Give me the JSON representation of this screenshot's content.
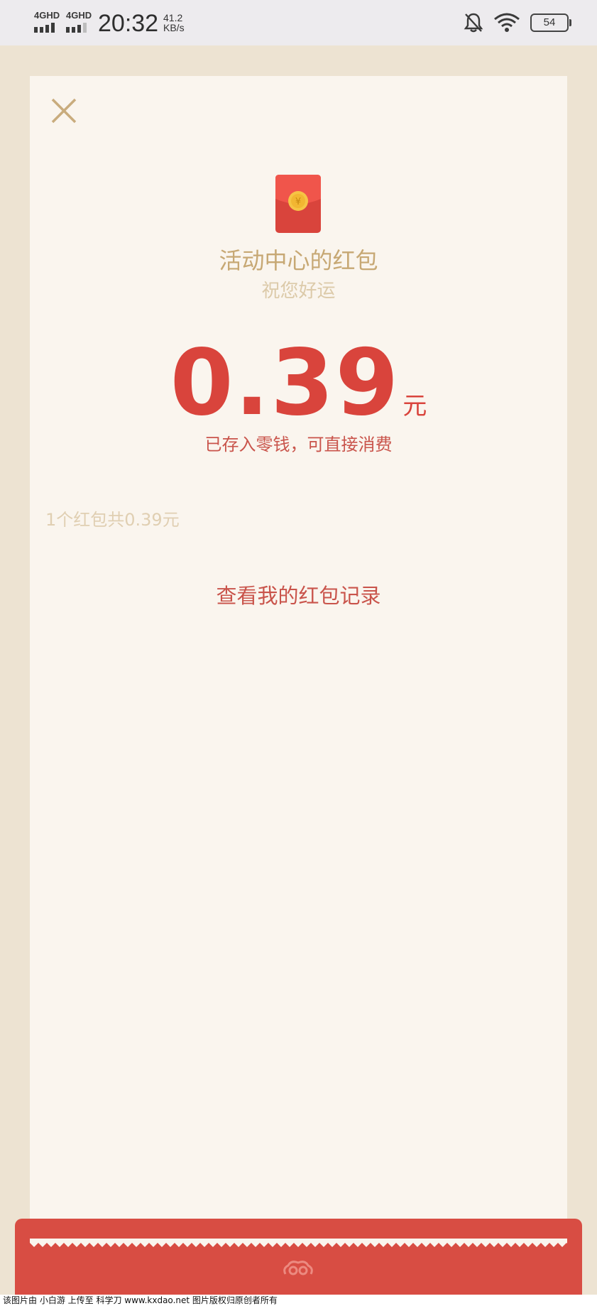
{
  "status_bar": {
    "signal1": "4GHD",
    "signal2": "4GHD",
    "time": "20:32",
    "speed_value": "41.2",
    "speed_unit": "KB/s",
    "battery": "54",
    "icons": [
      "signal-icon",
      "bell-off-icon",
      "wifi-icon",
      "battery-icon"
    ]
  },
  "packet": {
    "title": "活动中心的红包",
    "wish": "祝您好运",
    "amount": "0.39",
    "unit": "元",
    "note": "已存入零钱，可直接消费",
    "summary": "1个红包共0.39元",
    "records_link": "查看我的红包记录"
  },
  "footer": {
    "watermark": "该图片由 小白游 上传至 科学刀 www.kxdao.net 图片版权归原创者所有"
  },
  "colors": {
    "accent_red": "#d9443c",
    "gold": "#c7a874",
    "card_bg": "#faf5ee",
    "page_bg": "#ede3d2"
  }
}
